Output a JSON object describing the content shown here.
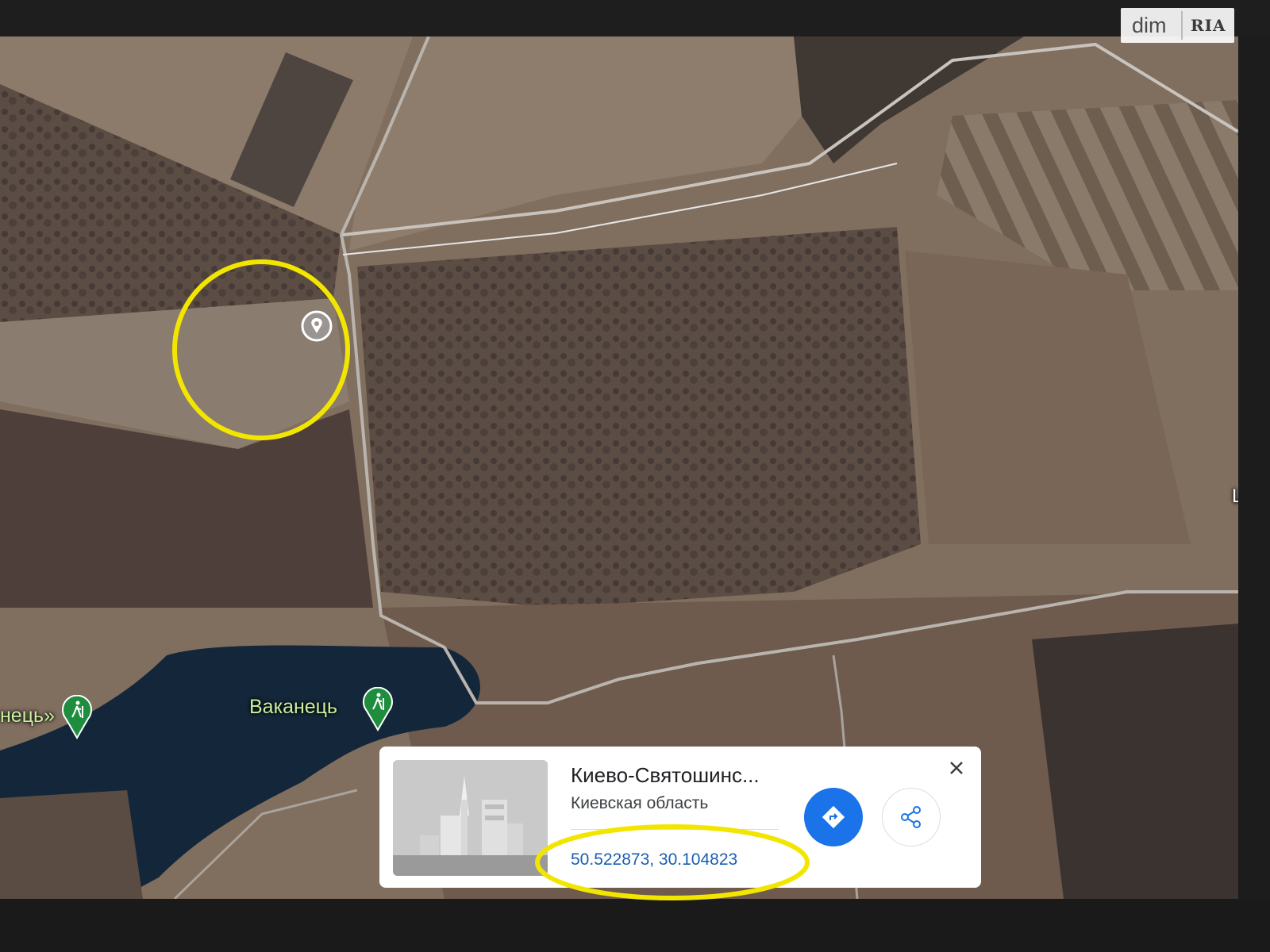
{
  "watermark": {
    "text": "dim",
    "logo_text": "RIA",
    "icon": "ria-logo-icon"
  },
  "map": {
    "type": "satellite",
    "highlight_color": "#f2e600",
    "labels": {
      "vakanets": "Ваканець",
      "left_partial": "нець»",
      "right_partial": "Lo"
    },
    "icons": [
      "hiking-poi-icon",
      "dropped-pin-icon"
    ]
  },
  "place_card": {
    "title": "Киево-Святошинс...",
    "subtitle": "Киевская область",
    "coordinates": "50.522873, 30.104823",
    "accent_color": "#1a73e8",
    "icons": [
      "close-icon",
      "directions-icon",
      "share-icon"
    ]
  }
}
